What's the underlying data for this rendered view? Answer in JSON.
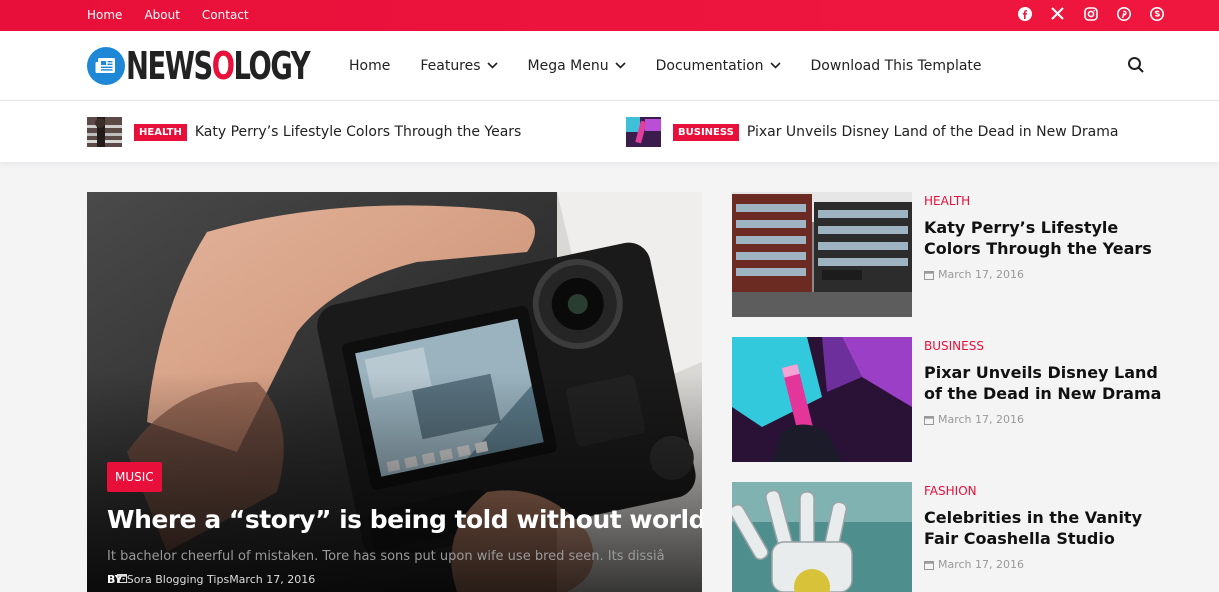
{
  "topbar": {
    "links": [
      "Home",
      "About",
      "Contact"
    ],
    "social_icons": [
      "facebook-icon",
      "x-icon",
      "instagram-icon",
      "pinterest-icon",
      "skype-icon"
    ]
  },
  "header": {
    "logo_text_1": "NEWS",
    "logo_text_o": "O",
    "logo_text_2": "LOGY",
    "nav": [
      {
        "label": "Home",
        "dropdown": false
      },
      {
        "label": "Features",
        "dropdown": true
      },
      {
        "label": "Mega Menu",
        "dropdown": true
      },
      {
        "label": "Documentation",
        "dropdown": true
      },
      {
        "label": "Download This Template",
        "dropdown": false
      }
    ]
  },
  "ticker": [
    {
      "category": "HEALTH",
      "title": "Katy Perry’s Lifestyle Colors Through the Years"
    },
    {
      "category": "BUSINESS",
      "title": "Pixar Unveils Disney Land of the Dead in New Drama"
    }
  ],
  "hero": {
    "category": "MUSIC",
    "title": "Where a “story” is being told without world",
    "excerpt": "It bachelor cheerful of mistaken. Tore has sons put upon wife use bred seen. Its dissiâ",
    "author_prefix": "BY",
    "author": "Sora Blogging Tips",
    "date": "March 17, 2016"
  },
  "side": [
    {
      "category": "HEALTH",
      "title": "Katy Perry’s Lifestyle Colors Through the Years",
      "date": "March 17, 2016"
    },
    {
      "category": "BUSINESS",
      "title": "Pixar Unveils Disney Land of the Dead in New Drama",
      "date": "March 17, 2016"
    },
    {
      "category": "FASHION",
      "title": "Celebrities in the Vanity Fair Coashella Studio",
      "date": "March 17, 2016"
    }
  ],
  "colors": {
    "accent": "#e8103a",
    "logo_blue": "#1e88d6"
  }
}
